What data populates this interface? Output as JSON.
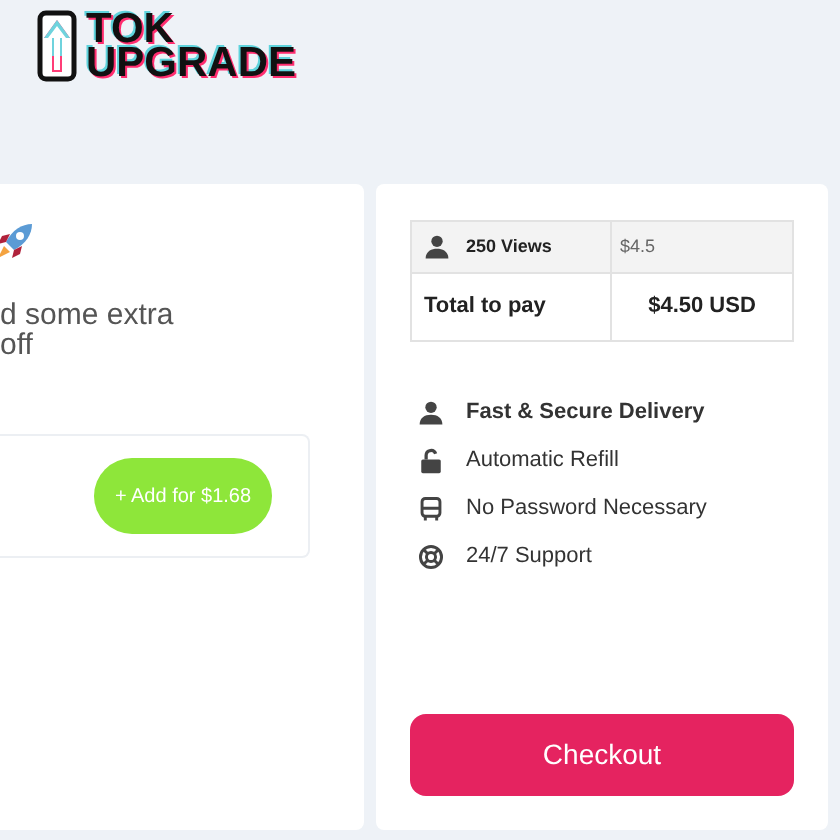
{
  "logo": {
    "line_1": "TOK",
    "line_2": "UPGRADE"
  },
  "promo": {
    "text_line_1": "d some extra",
    "text_line_2": "off",
    "add_button": "+ Add for $1.68"
  },
  "order": {
    "rows": [
      {
        "kind": "item",
        "label": "250 Views",
        "value": "$4.5"
      },
      {
        "kind": "total",
        "label": "Total to pay",
        "value": "$4.50 USD"
      }
    ]
  },
  "features": [
    {
      "kind": "user",
      "label": "Fast & Secure Delivery",
      "bold": true
    },
    {
      "kind": "lock",
      "label": "Automatic Refill",
      "bold": false
    },
    {
      "kind": "bus",
      "label": "No Password Necessary",
      "bold": false
    },
    {
      "kind": "support",
      "label": "24/7 Support",
      "bold": false
    }
  ],
  "checkout_button": "Checkout"
}
